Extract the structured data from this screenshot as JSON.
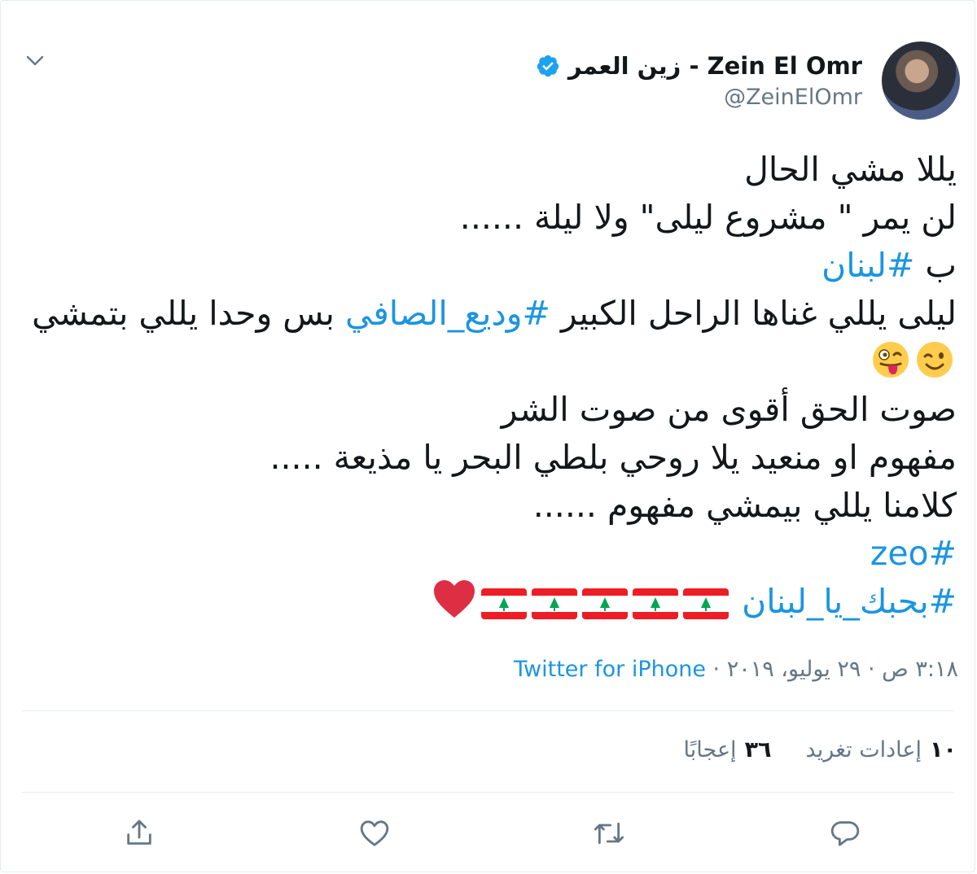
{
  "user": {
    "display_name": "زين العمر - Zein El Omr",
    "handle": "@ZeinElOmr",
    "verified": true
  },
  "tweet": {
    "line1": "يللا مشي الحال",
    "line2": "لن يمر \" مشروع ليلى\" ولا ليلة ......",
    "line3_prefix": "ب",
    "hashtag_lebanon": "#لبنان",
    "line4_before": "ليلى يللي غناها الراحل الكبير",
    "hashtag_wadih": "#وديع_الصافي",
    "line4_after": "بس وحدا يللي بتمشي",
    "line5": "صوت الحق أقوى من صوت الشر",
    "line6": "مفهوم او منعيد يلا روحي بلطي البحر يا مذيعة .....",
    "line7": "كلامنا يللي بيمشي مفهوم ......",
    "hashtag_zeo": "#zeo",
    "hashtag_love": "#بحبك_يا_لبنان"
  },
  "meta": {
    "time_date": "٣:١٨ ص · ٢٩ يوليو، ٢٠١٩ · ",
    "source": "Twitter for iPhone"
  },
  "stats": {
    "retweets_count": "١٠",
    "retweets_label": "إعادات تغريد",
    "likes_count": "٣٦",
    "likes_label": "إعجابًا"
  },
  "icons": {
    "verified": "verified-badge-icon",
    "chevron": "chevron-down-icon",
    "reply": "reply-icon",
    "retweet": "retweet-icon",
    "like": "heart-icon",
    "share": "share-icon"
  },
  "colors": {
    "link": "#1b95e0",
    "secondary_text": "#657786",
    "primary_text": "#14171a",
    "divider": "#e6ecf0"
  }
}
